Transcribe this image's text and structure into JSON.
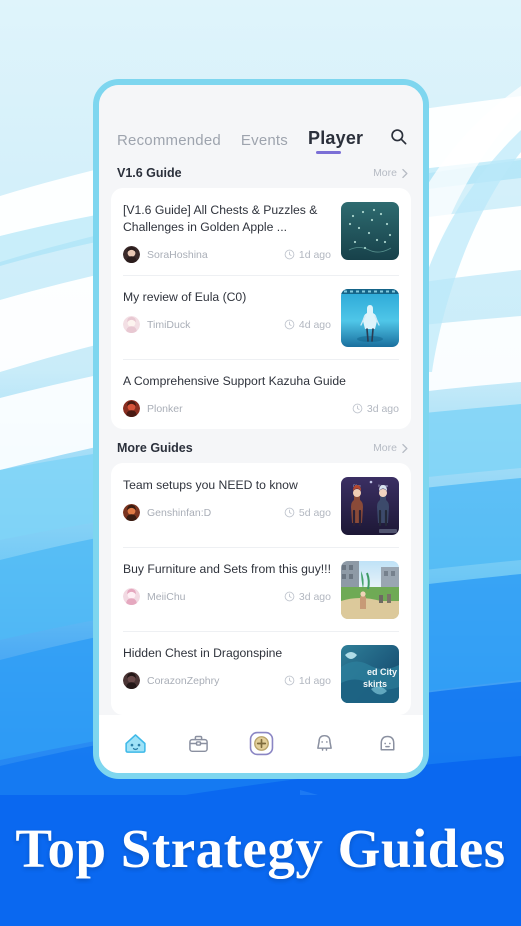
{
  "app": {
    "tabs": [
      {
        "label": "Recommended",
        "active": false
      },
      {
        "label": "Events",
        "active": false
      },
      {
        "label": "Player",
        "active": true
      }
    ],
    "search_icon": "search-icon",
    "accent_underline": "#7b6fd6",
    "frame_color": "#7ed6ef"
  },
  "sections": [
    {
      "title": "V1.6 Guide",
      "more_label": "More",
      "items": [
        {
          "title": "[V1.6 Guide] All Chests & Puzzles & Challenges in Golden Apple ...",
          "author": "SoraHoshina",
          "time": "1d ago",
          "thumb": "golden-apple-archipelago"
        },
        {
          "title": "My review of Eula (C0)",
          "author": "TimiDuck",
          "time": "4d ago",
          "thumb": "eula-character"
        },
        {
          "title": "A Comprehensive Support Kazuha Guide",
          "author": "Plonker",
          "time": "3d ago",
          "thumb": "none"
        }
      ]
    },
    {
      "title": "More Guides",
      "more_label": "More",
      "items": [
        {
          "title": "Team setups you NEED to know",
          "author": "Genshinfan:D",
          "time": "5d ago",
          "thumb": "team-setup"
        },
        {
          "title": "Buy Furniture and Sets from this guy!!!",
          "author": "MeiiChu",
          "time": "3d ago",
          "thumb": "furniture-village"
        },
        {
          "title": "Hidden Chest in Dragonspine",
          "author": "CorazonZephry",
          "time": "1d ago",
          "thumb": "dragonspine-map"
        }
      ]
    }
  ],
  "bottom_nav": [
    {
      "name": "home",
      "icon": "slime-home-icon",
      "active": true
    },
    {
      "name": "toolbox",
      "icon": "toolbox-icon",
      "active": false
    },
    {
      "name": "post",
      "icon": "add-plus-icon",
      "active": false
    },
    {
      "name": "notifications",
      "icon": "bell-icon",
      "active": false
    },
    {
      "name": "profile",
      "icon": "ghost-profile-icon",
      "active": false
    }
  ],
  "banner": {
    "headline": "Top Strategy Guides",
    "background": "#0a68f0"
  }
}
